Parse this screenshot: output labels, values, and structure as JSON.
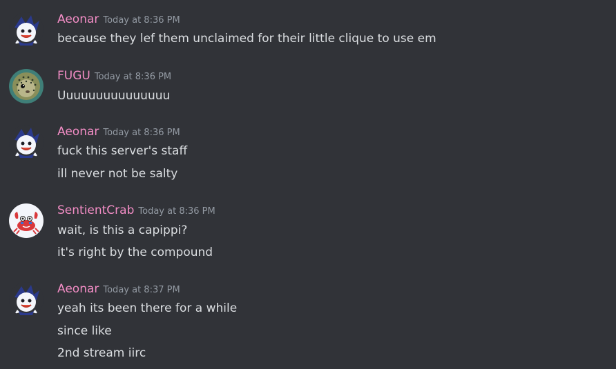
{
  "users": {
    "aeonar": "Aeonar",
    "fugu": "FUGU",
    "crab": "SentientCrab"
  },
  "colors": {
    "background": "#313338",
    "username": "#f28dc5",
    "timestamp": "#949ba4",
    "text": "#dbdee1"
  },
  "messages": [
    {
      "author": "Aeonar",
      "timestamp": "Today at 8:36 PM",
      "avatar_icon": "jack-frost-avatar-icon",
      "lines": [
        "because they lef them unclaimed for their little clique to use em"
      ]
    },
    {
      "author": "FUGU",
      "timestamp": "Today at 8:36 PM",
      "avatar_icon": "pufferfish-avatar-icon",
      "lines": [
        "Uuuuuuuuuuuuuuu"
      ]
    },
    {
      "author": "Aeonar",
      "timestamp": "Today at 8:36 PM",
      "avatar_icon": "jack-frost-avatar-icon",
      "lines": [
        "fuck this server's staff",
        "ill never not be salty"
      ]
    },
    {
      "author": "SentientCrab",
      "timestamp": "Today at 8:36 PM",
      "avatar_icon": "crab-avatar-icon",
      "lines": [
        "wait, is this a capippi?",
        "it's right by the compound"
      ]
    },
    {
      "author": "Aeonar",
      "timestamp": "Today at 8:37 PM",
      "avatar_icon": "jack-frost-avatar-icon",
      "lines": [
        "yeah its been there for a while",
        "since like",
        "2nd stream iirc"
      ]
    }
  ]
}
